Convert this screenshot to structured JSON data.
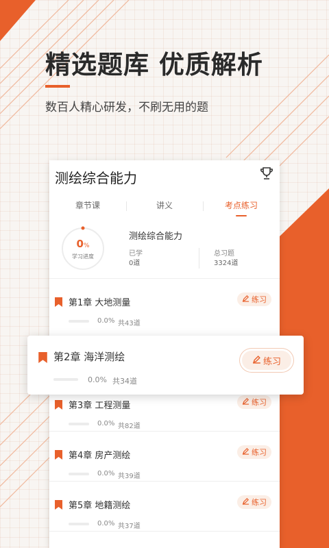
{
  "hero": {
    "title": "精选题库  优质解析",
    "subtitle": "数百人精心研发，不刷无用的题"
  },
  "card": {
    "title": "测绘综合能力",
    "tabs": [
      {
        "label": "章节课",
        "active": false
      },
      {
        "label": "讲义",
        "active": false
      },
      {
        "label": "考点练习",
        "active": true
      }
    ],
    "summary": {
      "progress_value": "0",
      "progress_unit": "%",
      "progress_label": "学习进度",
      "subject": "测绘综合能力",
      "learned_label": "已学",
      "learned_value": "0道",
      "total_label": "总习题",
      "total_value": "3324道"
    },
    "practice_label": "练习",
    "chapters": [
      {
        "title": "第1章 大地测量",
        "percent": "0.0%",
        "total": "共43道",
        "progress": 0
      },
      {
        "title": "第2章 海洋测绘",
        "percent": "0.0%",
        "total": "共34道",
        "progress": 0
      },
      {
        "title": "第3章 工程测量",
        "percent": "0.0%",
        "total": "共82道",
        "progress": 0
      },
      {
        "title": "第4章 房产测绘",
        "percent": "0.0%",
        "total": "共39道",
        "progress": 0
      },
      {
        "title": "第5章 地籍测绘",
        "percent": "0.0%",
        "total": "共37道",
        "progress": 0
      }
    ]
  },
  "colors": {
    "accent": "#e8602b",
    "accent_light": "#fbeee6",
    "background": "#f8f5f2"
  },
  "icons": {
    "trophy": "trophy-icon",
    "bookmark": "bookmark-icon",
    "pencil": "pencil-icon"
  }
}
